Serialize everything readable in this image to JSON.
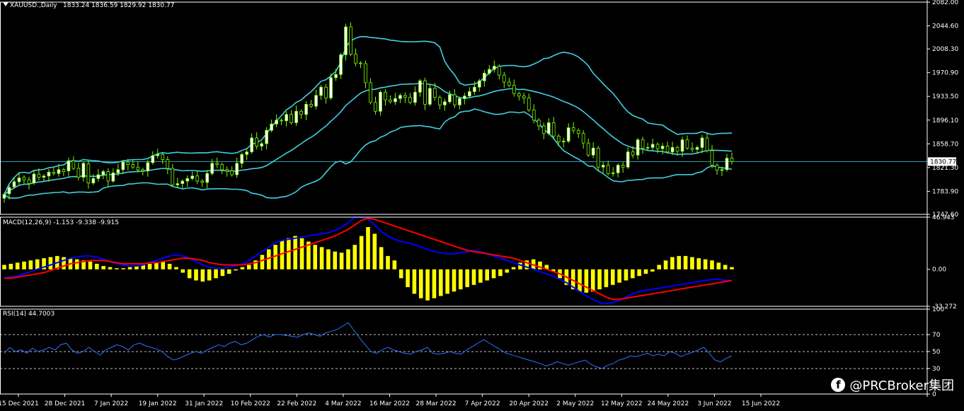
{
  "chart_data": {
    "type": "candlestick",
    "symbol": "XAUUSD.,Daily",
    "ohlc_header": "1833.24 1836.59 1829.92 1830.77",
    "colors": {
      "background": "#000000",
      "bull": "#ffffff",
      "bear": "#ffffff",
      "wick": "#7CFC00",
      "bollinger": "#40d0e0",
      "macd": "#0000ff",
      "signal": "#ff0000",
      "histogram": "#ffff00",
      "rsi": "#3070ff",
      "grid": "#ffffff",
      "current_price_line": "#40d0e0"
    },
    "price_axis": {
      "ticks": [
        "2082.00",
        "2044.60",
        "2008.30",
        "1970.90",
        "1933.50",
        "1896.10",
        "1858.70",
        "1821.30",
        "1783.90",
        "1747.60"
      ],
      "ylim": [
        1747.6,
        2082.0
      ],
      "current_price": "1830.77"
    },
    "x_dates": [
      "15 Dec 2021",
      "28 Dec 2021",
      "7 Jan 2022",
      "19 Jan 2022",
      "31 Jan 2022",
      "10 Feb 2022",
      "22 Feb 2022",
      "4 Mar 2022",
      "16 Mar 2022",
      "28 Mar 2022",
      "7 Apr 2022",
      "20 Apr 2022",
      "2 May 2022",
      "12 May 2022",
      "24 May 2022",
      "3 Jun 2022",
      "15 Jun 2022"
    ],
    "close": [
      1779,
      1790,
      1799,
      1805,
      1802,
      1796,
      1811,
      1806,
      1808,
      1814,
      1812,
      1818,
      1815,
      1832,
      1820,
      1806,
      1828,
      1797,
      1804,
      1810,
      1815,
      1800,
      1813,
      1818,
      1830,
      1826,
      1822,
      1818,
      1816,
      1829,
      1840,
      1842,
      1834,
      1820,
      1794,
      1796,
      1800,
      1804,
      1808,
      1800,
      1798,
      1812,
      1828,
      1826,
      1818,
      1816,
      1810,
      1828,
      1842,
      1846,
      1868,
      1855,
      1859,
      1880,
      1890,
      1896,
      1895,
      1905,
      1892,
      1910,
      1905,
      1921,
      1918,
      1935,
      1948,
      1931,
      1963,
      1968,
      1999,
      2043,
      2000,
      1986,
      1985,
      1955,
      1924,
      1910,
      1940,
      1928,
      1925,
      1930,
      1935,
      1932,
      1924,
      1940,
      1958,
      1921,
      1946,
      1932,
      1920,
      1925,
      1936,
      1920,
      1930,
      1934,
      1941,
      1948,
      1958,
      1970,
      1976,
      1981,
      1967,
      1956,
      1951,
      1938,
      1934,
      1931,
      1912,
      1896,
      1887,
      1875,
      1892,
      1871,
      1862,
      1863,
      1884,
      1880,
      1875,
      1860,
      1841,
      1852,
      1822,
      1825,
      1812,
      1813,
      1825,
      1822,
      1846,
      1841,
      1865,
      1852,
      1853,
      1858,
      1851,
      1855,
      1846,
      1853,
      1847,
      1865,
      1852,
      1850,
      1853,
      1868,
      1848,
      1825,
      1817,
      1818,
      1836,
      1831
    ],
    "open_offset": [
      -6,
      -10,
      -8,
      -6,
      4,
      6,
      -14,
      5,
      -2,
      -6,
      2,
      -6,
      3,
      -16,
      12,
      14,
      -22,
      30,
      -7,
      -6,
      -5,
      15,
      -13,
      -5,
      -12,
      4,
      4,
      4,
      2,
      -13,
      -11,
      -2,
      8,
      14,
      26,
      -2,
      -4,
      -4,
      -4,
      8,
      2,
      -14,
      -16,
      2,
      8,
      2,
      6,
      -18,
      -14,
      -4,
      -22,
      13,
      -4,
      -21,
      -10,
      -6,
      1,
      -10,
      13,
      -18,
      5,
      -16,
      3,
      -17,
      -13,
      17,
      -32,
      -5,
      -31,
      -44,
      43,
      14,
      1,
      30,
      31,
      14,
      -30,
      12,
      3,
      -5,
      -5,
      3,
      8,
      -16,
      -18,
      37,
      -25,
      14,
      12,
      -5,
      -11,
      16,
      -10,
      -4,
      -7,
      -7,
      -10,
      -12,
      -6,
      -5,
      14,
      11,
      5,
      13,
      4,
      3,
      19,
      16,
      9,
      12,
      -17,
      21,
      9,
      -1,
      -21,
      4,
      5,
      15,
      19,
      -11,
      30,
      -3,
      13,
      -1,
      -12,
      3,
      -24,
      5,
      -24,
      13,
      -1,
      -5,
      7,
      -4,
      9,
      -7,
      6,
      -18,
      13,
      2,
      -3,
      -15,
      20,
      23,
      8,
      -1,
      -18,
      5
    ],
    "macd_label": "MACD(12,26,9) -1.153 -9.338 -9.915",
    "macd_axis": {
      "ticks": [
        "46.943",
        "0.00",
        "-33.272"
      ],
      "ylim": [
        -33.272,
        46.943
      ]
    },
    "macd_hist": [
      4,
      5,
      6,
      7,
      8,
      9,
      10,
      11,
      12,
      11,
      10,
      9,
      8,
      7,
      5,
      3,
      2,
      1,
      1,
      2,
      3,
      4,
      5,
      6,
      7,
      5,
      2,
      -3,
      -8,
      -10,
      -11,
      -10,
      -8,
      -6,
      -4,
      -1,
      2,
      4,
      8,
      13,
      18,
      22,
      26,
      28,
      30,
      28,
      25,
      22,
      20,
      18,
      16,
      15,
      18,
      22,
      30,
      38,
      32,
      20,
      12,
      8,
      -8,
      -16,
      -22,
      -26,
      -28,
      -26,
      -24,
      -22,
      -20,
      -18,
      -16,
      -14,
      -12,
      -10,
      -8,
      -6,
      -3,
      2,
      6,
      8,
      9,
      7,
      4,
      -2,
      -8,
      -14,
      -18,
      -20,
      -21,
      -20,
      -18,
      -16,
      -14,
      -12,
      -10,
      -8,
      -6,
      -4,
      -2,
      4,
      8,
      11,
      12,
      12,
      11,
      10,
      9,
      8,
      6,
      4,
      2
    ],
    "macd_line": [
      -8,
      -7,
      -6,
      -4,
      -2,
      0,
      2,
      4,
      6,
      8,
      10,
      11,
      12,
      12,
      11,
      9,
      7,
      5,
      4,
      3,
      3,
      4,
      6,
      8,
      10,
      12,
      13,
      12,
      10,
      7,
      4,
      2,
      1,
      1,
      2,
      3,
      5,
      8,
      12,
      16,
      20,
      24,
      26,
      27,
      28,
      29,
      30,
      31,
      32,
      33,
      35,
      38,
      42,
      47,
      47,
      45,
      40,
      34,
      30,
      27,
      25,
      24,
      22,
      20,
      18,
      16,
      15,
      14,
      14,
      15,
      16,
      17,
      16,
      14,
      12,
      10,
      8,
      6,
      4,
      2,
      0,
      -2,
      -4,
      -6,
      -9,
      -12,
      -16,
      -20,
      -24,
      -27,
      -30,
      -31,
      -30,
      -28,
      -25,
      -22,
      -20,
      -19,
      -18,
      -17,
      -16,
      -15,
      -14,
      -13,
      -12,
      -11,
      -10,
      -9,
      -9,
      -10,
      -10
    ],
    "signal_line": [
      -8,
      -8,
      -7,
      -6,
      -5,
      -4,
      -3,
      -1,
      1,
      3,
      5,
      6,
      7,
      8,
      8,
      8,
      7,
      6,
      5,
      5,
      5,
      5,
      6,
      6,
      7,
      8,
      9,
      10,
      10,
      9,
      8,
      6,
      5,
      4,
      4,
      4,
      4,
      5,
      6,
      8,
      10,
      12,
      14,
      16,
      18,
      20,
      22,
      24,
      26,
      28,
      30,
      33,
      36,
      40,
      44,
      46,
      45,
      43,
      41,
      39,
      37,
      35,
      33,
      31,
      29,
      27,
      25,
      23,
      21,
      19,
      17,
      16,
      15,
      14,
      13,
      12,
      11,
      10,
      8,
      6,
      4,
      2,
      0,
      -2,
      -4,
      -7,
      -10,
      -13,
      -16,
      -19,
      -22,
      -25,
      -27,
      -27,
      -26,
      -25,
      -24,
      -23,
      -22,
      -21,
      -20,
      -19,
      -18,
      -17,
      -16,
      -15,
      -14,
      -13,
      -12,
      -11,
      -10
    ],
    "rsi_label": "RSI(14) 44.7003",
    "rsi_axis": {
      "ticks": [
        "100",
        "70",
        "50",
        "30",
        "0"
      ],
      "levels": [
        70,
        50,
        30
      ]
    },
    "rsi": [
      48,
      55,
      50,
      52,
      48,
      54,
      50,
      52,
      55,
      52,
      58,
      60,
      52,
      48,
      50,
      55,
      50,
      46,
      52,
      55,
      58,
      56,
      52,
      58,
      60,
      57,
      55,
      53,
      50,
      44,
      40,
      42,
      45,
      48,
      50,
      48,
      52,
      55,
      58,
      56,
      60,
      62,
      58,
      60,
      64,
      68,
      70,
      67,
      70,
      70,
      69,
      68,
      67,
      70,
      72,
      70,
      68,
      72,
      74,
      76,
      80,
      84,
      75,
      66,
      58,
      50,
      48,
      52,
      55,
      52,
      50,
      48,
      47,
      50,
      52,
      55,
      48,
      47,
      48,
      50,
      48,
      47,
      52,
      56,
      60,
      64,
      60,
      56,
      52,
      48,
      46,
      44,
      42,
      40,
      38,
      36,
      33,
      35,
      38,
      36,
      34,
      36,
      38,
      40,
      35,
      32,
      30,
      34,
      36,
      40,
      42,
      45,
      44,
      46,
      48,
      45,
      47,
      45,
      50,
      48,
      44,
      47,
      49,
      52,
      55,
      48,
      40,
      38,
      42,
      45
    ],
    "watermark": "@PRCBroker集团"
  }
}
